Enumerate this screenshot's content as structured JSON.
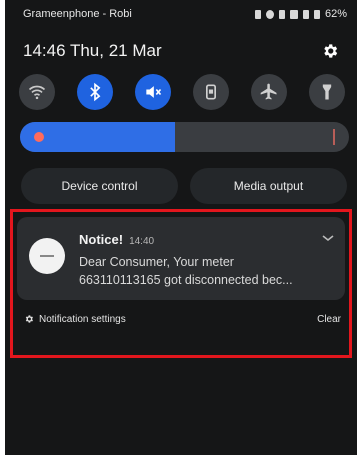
{
  "status_bar": {
    "carrier": "Grameenphone - Robi",
    "battery": "62%"
  },
  "header": {
    "time_date": "14:46  Thu, 21 Mar"
  },
  "quick_toggles": [
    {
      "name": "wifi",
      "icon": "wifi-icon",
      "on": false
    },
    {
      "name": "bluetooth",
      "icon": "bluetooth-icon",
      "on": true
    },
    {
      "name": "sound",
      "icon": "mute-icon",
      "on": true
    },
    {
      "name": "auto-rotate",
      "icon": "portrait-lock-icon",
      "on": false
    },
    {
      "name": "airplane",
      "icon": "airplane-icon",
      "on": false
    },
    {
      "name": "flashlight",
      "icon": "flashlight-icon",
      "on": false
    }
  ],
  "brightness": {
    "level": 0.47
  },
  "controls": {
    "device_control": "Device control",
    "media_output": "Media output"
  },
  "notification": {
    "title": "Notice!",
    "time": "14:40",
    "body_line1": "Dear Consumer, Your meter",
    "body_line2": "663110113165 got disconnected bec..."
  },
  "footer": {
    "settings_label": "Notification settings",
    "clear_label": "Clear"
  },
  "colors": {
    "accent_blue": "#1f63e0",
    "highlight_red": "#e3161d"
  }
}
